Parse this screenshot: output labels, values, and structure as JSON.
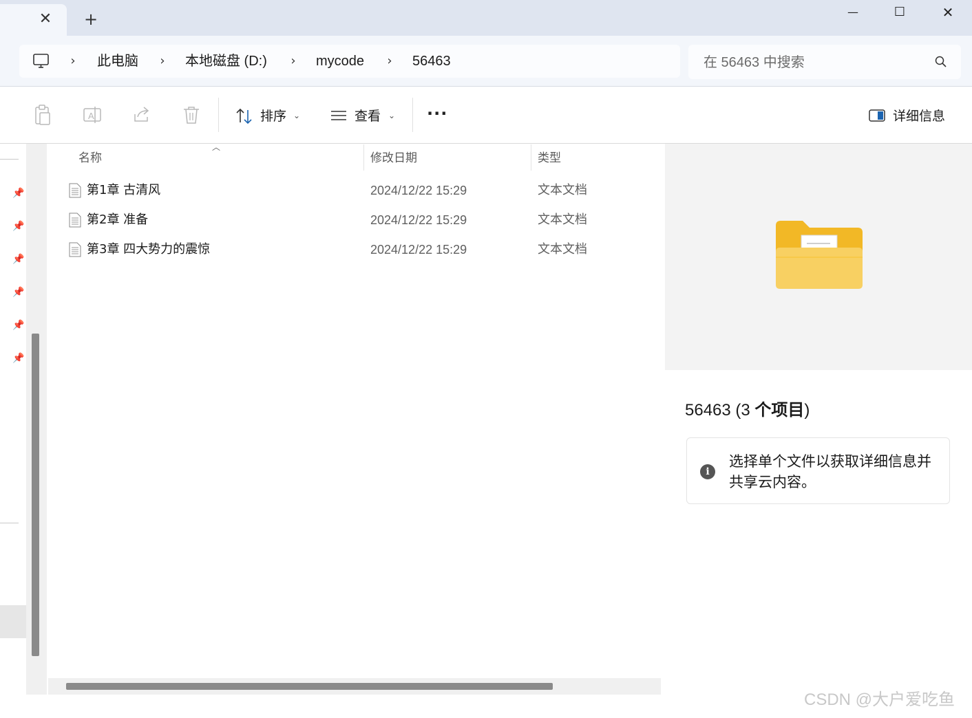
{
  "tabbar": {
    "close_glyph": "✕",
    "new_tab_glyph": "+"
  },
  "window_controls": {
    "minimize_glyph": "—",
    "maximize_glyph": "☐",
    "close_glyph": "✕"
  },
  "address": {
    "crumbs": [
      "此电脑",
      "本地磁盘 (D:)",
      "mycode",
      "56463"
    ],
    "separator": "›"
  },
  "search": {
    "placeholder": "在 56463 中搜索"
  },
  "toolbar": {
    "sort_label": "排序",
    "view_label": "查看",
    "more_glyph": "···",
    "details_label": "详细信息",
    "caret": "⌄"
  },
  "columns": {
    "name": "名称",
    "date": "修改日期",
    "type": "类型"
  },
  "files": [
    {
      "name": "第1章 古清风",
      "date": "2024/12/22 15:29",
      "type": "文本文档"
    },
    {
      "name": "第2章 准备",
      "date": "2024/12/22 15:29",
      "type": "文本文档"
    },
    {
      "name": "第3章 四大势力的震惊",
      "date": "2024/12/22 15:29",
      "type": "文本文档"
    }
  ],
  "details_pane": {
    "title_prefix": "56463 (3 ",
    "title_bold": "个项目",
    "title_suffix": ")",
    "info_glyph": "i",
    "info_text": "选择单个文件以获取详细信息并共享云内容。"
  },
  "watermark": "CSDN @大户爱吃鱼",
  "colors": {
    "tabbar_bg": "#dfe5f0",
    "address_bg": "#f3f6fb",
    "folder_yellow": "#f7c949",
    "accent_blue": "#1c64b0"
  }
}
